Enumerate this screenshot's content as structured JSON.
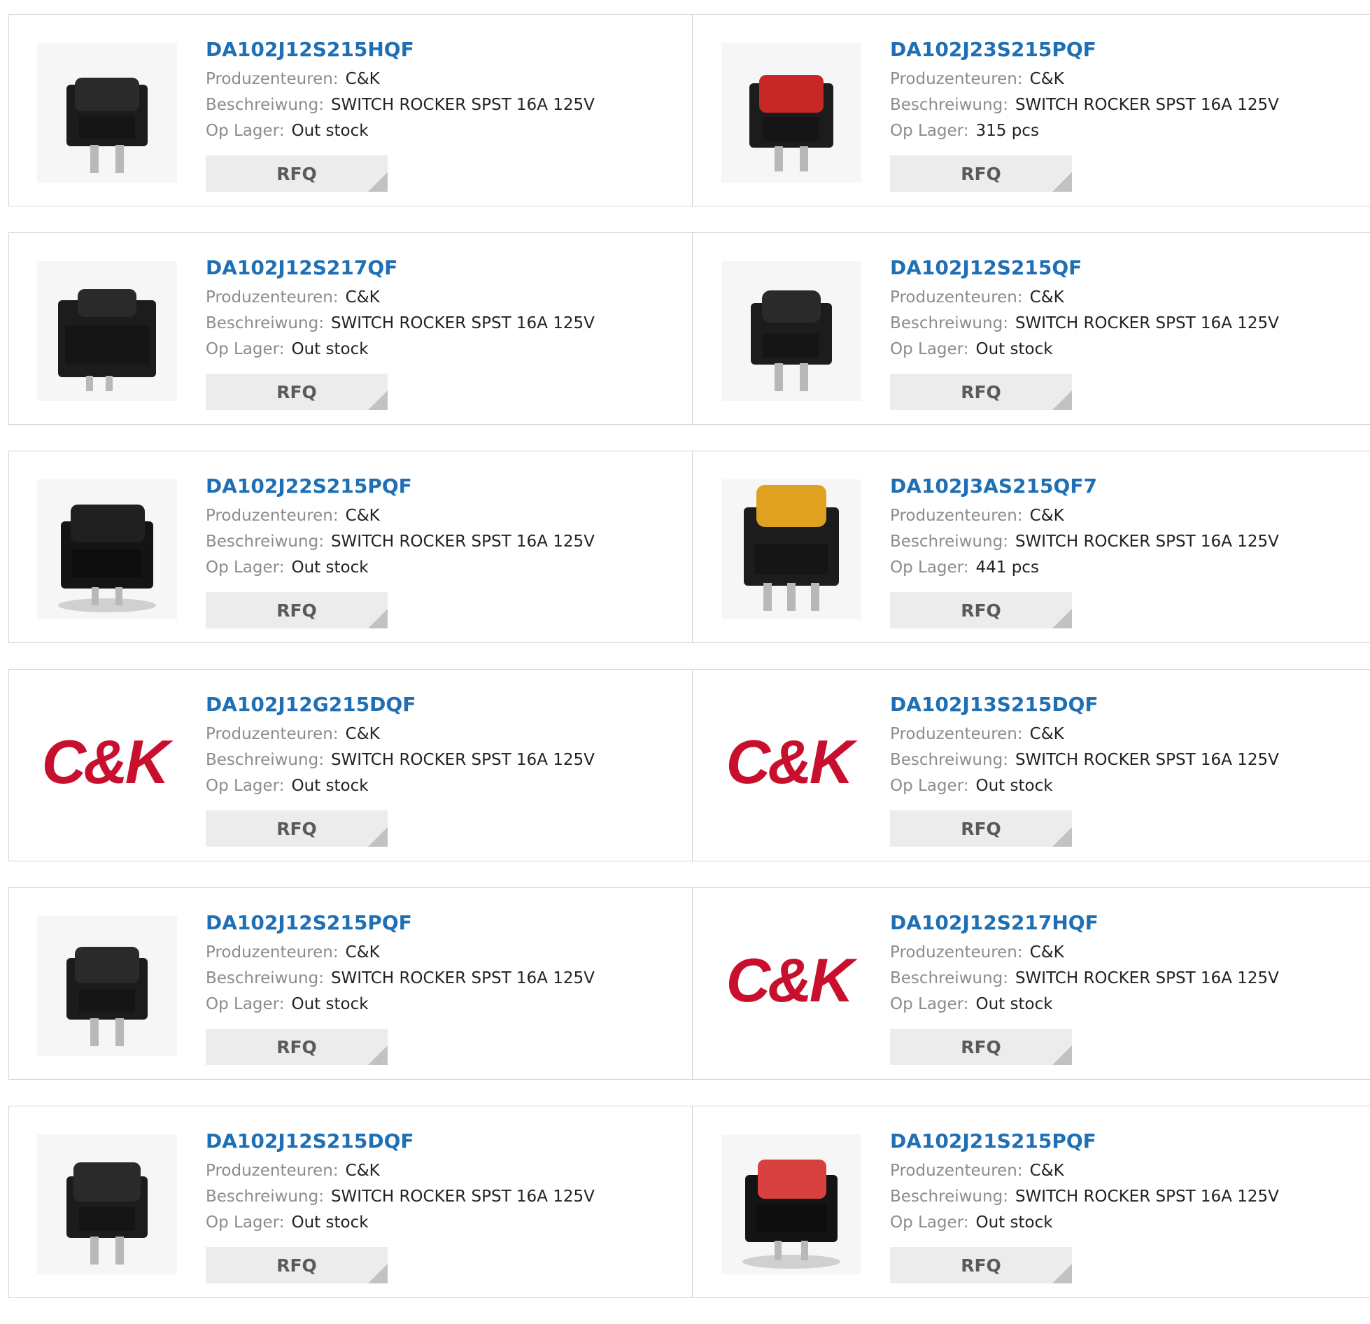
{
  "labels": {
    "manufacturer": "Produzenteuren:",
    "description": "Beschreiwung:",
    "stock": "Op Lager:",
    "rfq": "RFQ"
  },
  "colors": {
    "part_number": "#1f6fb5",
    "brand_red": "#c8102e",
    "rfq_bg": "#ececec"
  },
  "products": [
    {
      "part": "DA102J12S215HQF",
      "manufacturer": "C&K",
      "description": "SWITCH ROCKER SPST 16A 125V",
      "stock": "Out stock",
      "image": "rocker-switch-black-icon"
    },
    {
      "part": "DA102J23S215PQF",
      "manufacturer": "C&K",
      "description": "SWITCH ROCKER SPST 16A 125V",
      "stock": "315 pcs",
      "image": "rocker-switch-red-icon"
    },
    {
      "part": "DA102J12S217QF",
      "manufacturer": "C&K",
      "description": "SWITCH ROCKER SPST 16A 125V",
      "stock": "Out stock",
      "image": "rocker-switch-black-icon"
    },
    {
      "part": "DA102J12S215QF",
      "manufacturer": "C&K",
      "description": "SWITCH ROCKER SPST 16A 125V",
      "stock": "Out stock",
      "image": "rocker-switch-black-icon"
    },
    {
      "part": "DA102J22S215PQF",
      "manufacturer": "C&K",
      "description": "SWITCH ROCKER SPST 16A 125V",
      "stock": "Out stock",
      "image": "rocker-switch-black-icon"
    },
    {
      "part": "DA102J3AS215QF7",
      "manufacturer": "C&K",
      "description": "SWITCH ROCKER SPST 16A 125V",
      "stock": "441 pcs",
      "image": "rocker-switch-amber-icon"
    },
    {
      "part": "DA102J12G215DQF",
      "manufacturer": "C&K",
      "description": "SWITCH ROCKER SPST 16A 125V",
      "stock": "Out stock",
      "image": "ck-logo",
      "logo_text": "C&K"
    },
    {
      "part": "DA102J13S215DQF",
      "manufacturer": "C&K",
      "description": "SWITCH ROCKER SPST 16A 125V",
      "stock": "Out stock",
      "image": "ck-logo",
      "logo_text": "C&K"
    },
    {
      "part": "DA102J12S215PQF",
      "manufacturer": "C&K",
      "description": "SWITCH ROCKER SPST 16A 125V",
      "stock": "Out stock",
      "image": "rocker-switch-black-icon"
    },
    {
      "part": "DA102J12S217HQF",
      "manufacturer": "C&K",
      "description": "SWITCH ROCKER SPST 16A 125V",
      "stock": "Out stock",
      "image": "ck-logo",
      "logo_text": "C&K"
    },
    {
      "part": "DA102J12S215DQF",
      "manufacturer": "C&K",
      "description": "SWITCH ROCKER SPST 16A 125V",
      "stock": "Out stock",
      "image": "rocker-switch-black-icon"
    },
    {
      "part": "DA102J21S215PQF",
      "manufacturer": "C&K",
      "description": "SWITCH ROCKER SPST 16A 125V",
      "stock": "Out stock",
      "image": "rocker-switch-red-icon"
    }
  ]
}
